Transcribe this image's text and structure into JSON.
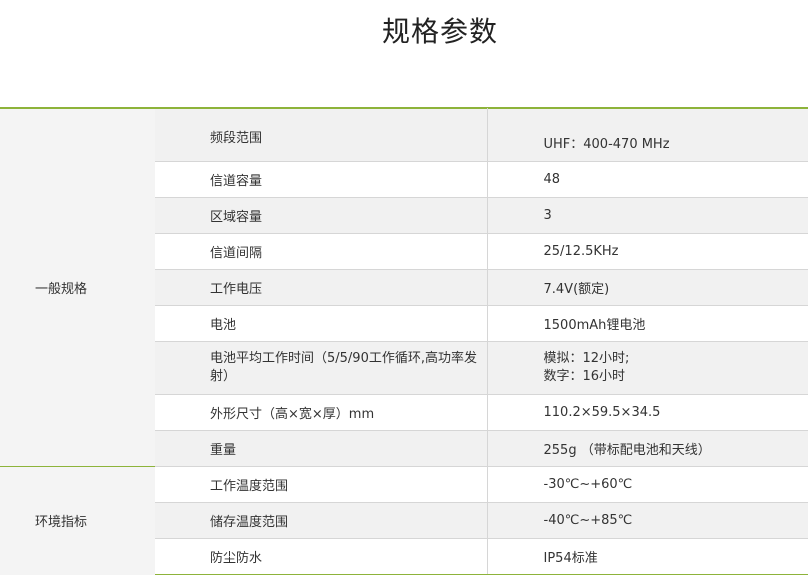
{
  "page_title": "规格参数",
  "groups": [
    {
      "name": "一般规格",
      "rows": [
        {
          "label": "频段范围",
          "value": "UHF：400-470 MHz"
        },
        {
          "label": "信道容量",
          "value": "48"
        },
        {
          "label": "区域容量",
          "value": "3"
        },
        {
          "label": "信道间隔",
          "value": "25/12.5KHz"
        },
        {
          "label": "工作电压",
          "value": "7.4V(额定)"
        },
        {
          "label": "电池",
          "value": "1500mAh锂电池"
        },
        {
          "label_line1": "电池平均工作时间（5/5/90工作循环,高功率发",
          "label_line2": "射）",
          "value_line1": "模拟：12小时;",
          "value_line2": "数字：16小时"
        },
        {
          "label": "外形尺寸（高×宽×厚）mm",
          "value": "110.2×59.5×34.5"
        },
        {
          "label": "重量",
          "value": "255g （带标配电池和天线）"
        }
      ]
    },
    {
      "name": "环境指标",
      "rows": [
        {
          "label": "工作温度范围",
          "value": "-30℃~+60℃"
        },
        {
          "label": "储存温度范围",
          "value": "-40℃~+85℃"
        },
        {
          "label": "防尘防水",
          "value": "IP54标准"
        }
      ]
    }
  ]
}
